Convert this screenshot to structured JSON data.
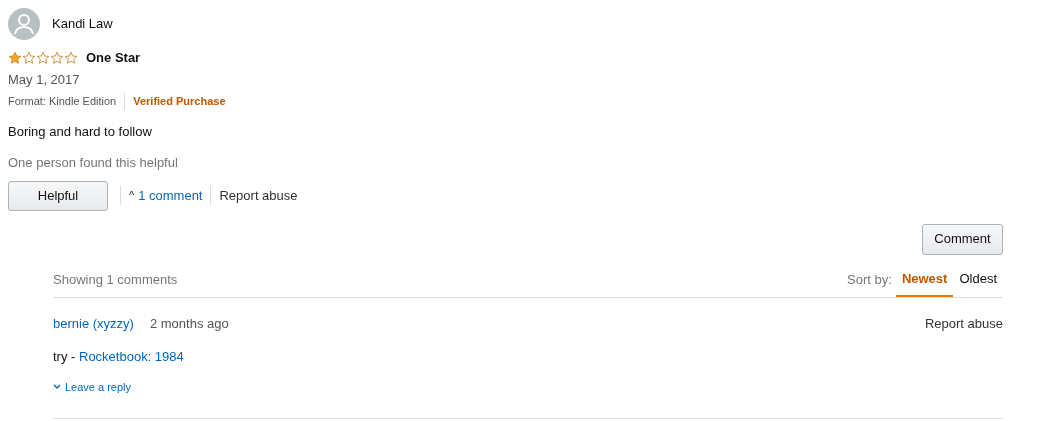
{
  "review": {
    "author": "Kandi Law",
    "stars": 1,
    "title": "One Star",
    "date": "May 1, 2017",
    "format": "Format: Kindle Edition",
    "badge": "Verified Purchase",
    "body": "Boring and hard to follow",
    "helpful_count": "One person found this helpful",
    "helpful_button": "Helpful",
    "comments_toggle": {
      "icon": "^",
      "label": "1 comment",
      "expanded": true
    },
    "report": "Report abuse"
  },
  "comment_button": "Comment",
  "comments": {
    "heading": "Showing 1 comments",
    "sort_label": "Sort by:",
    "sort_options": [
      {
        "label": "Newest",
        "selected": true
      },
      {
        "label": "Oldest",
        "selected": false
      }
    ],
    "items": [
      {
        "author": "bernie (xyzzy)",
        "time": "2 months ago",
        "report": "Report abuse",
        "text": "try - ",
        "link": "Rocketbook: 1984",
        "reply": "Leave a reply"
      }
    ]
  }
}
